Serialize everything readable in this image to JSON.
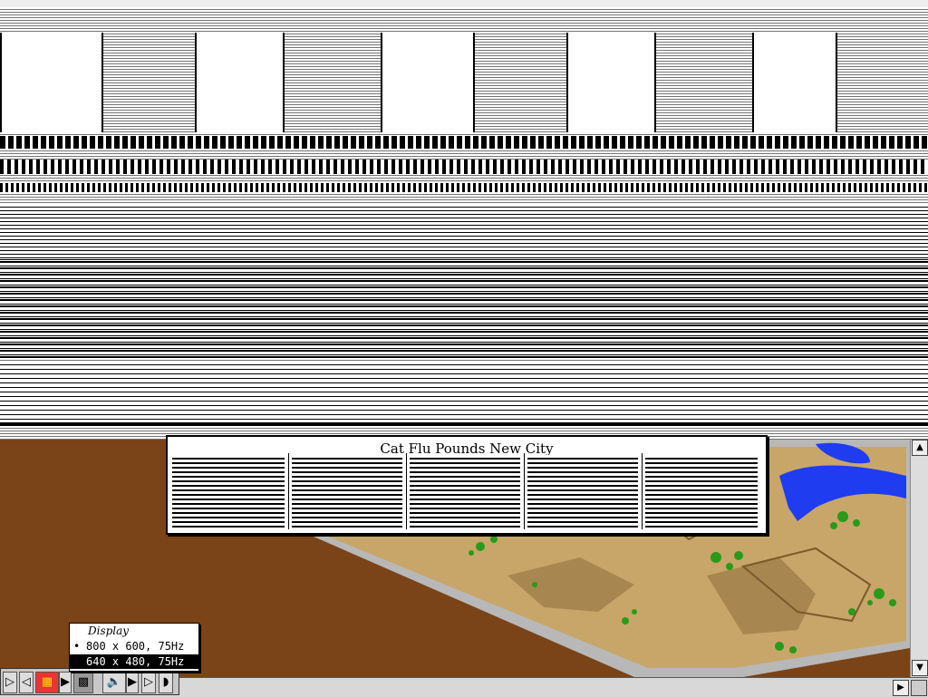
{
  "newspaper": {
    "headline": "Cat Flu Pounds New City"
  },
  "display_menu": {
    "title": "Display",
    "options": [
      {
        "label": "800 x 600, 75Hz",
        "checked": true
      },
      {
        "label": "640 x 480, 75Hz",
        "checked": false,
        "highlighted": true
      }
    ],
    "check_mark": "•"
  },
  "control_strip": {
    "items": [
      {
        "name": "collapse-arrow",
        "glyph": "▷"
      },
      {
        "name": "back-arrow",
        "glyph": "◁"
      },
      {
        "name": "monitor-colors",
        "glyph": "▦"
      },
      {
        "name": "expand-arrow",
        "glyph": "▶"
      },
      {
        "name": "monitor-resolution",
        "glyph": "▩"
      },
      {
        "name": "speaker",
        "glyph": "🔈"
      },
      {
        "name": "volume-arrow",
        "glyph": "▶"
      },
      {
        "name": "forward-arrow",
        "glyph": "▷"
      },
      {
        "name": "tab-end",
        "glyph": "◗"
      }
    ]
  },
  "scrollbar": {
    "up_glyph": "▲",
    "down_glyph": "▼",
    "left_glyph": "◀",
    "right_glyph": "▶"
  },
  "colors": {
    "dirt": "#7a4418",
    "water": "#1f3cf0",
    "land": "#c8a66a",
    "trees": "#2a9a1a",
    "highlight": "#000000"
  }
}
